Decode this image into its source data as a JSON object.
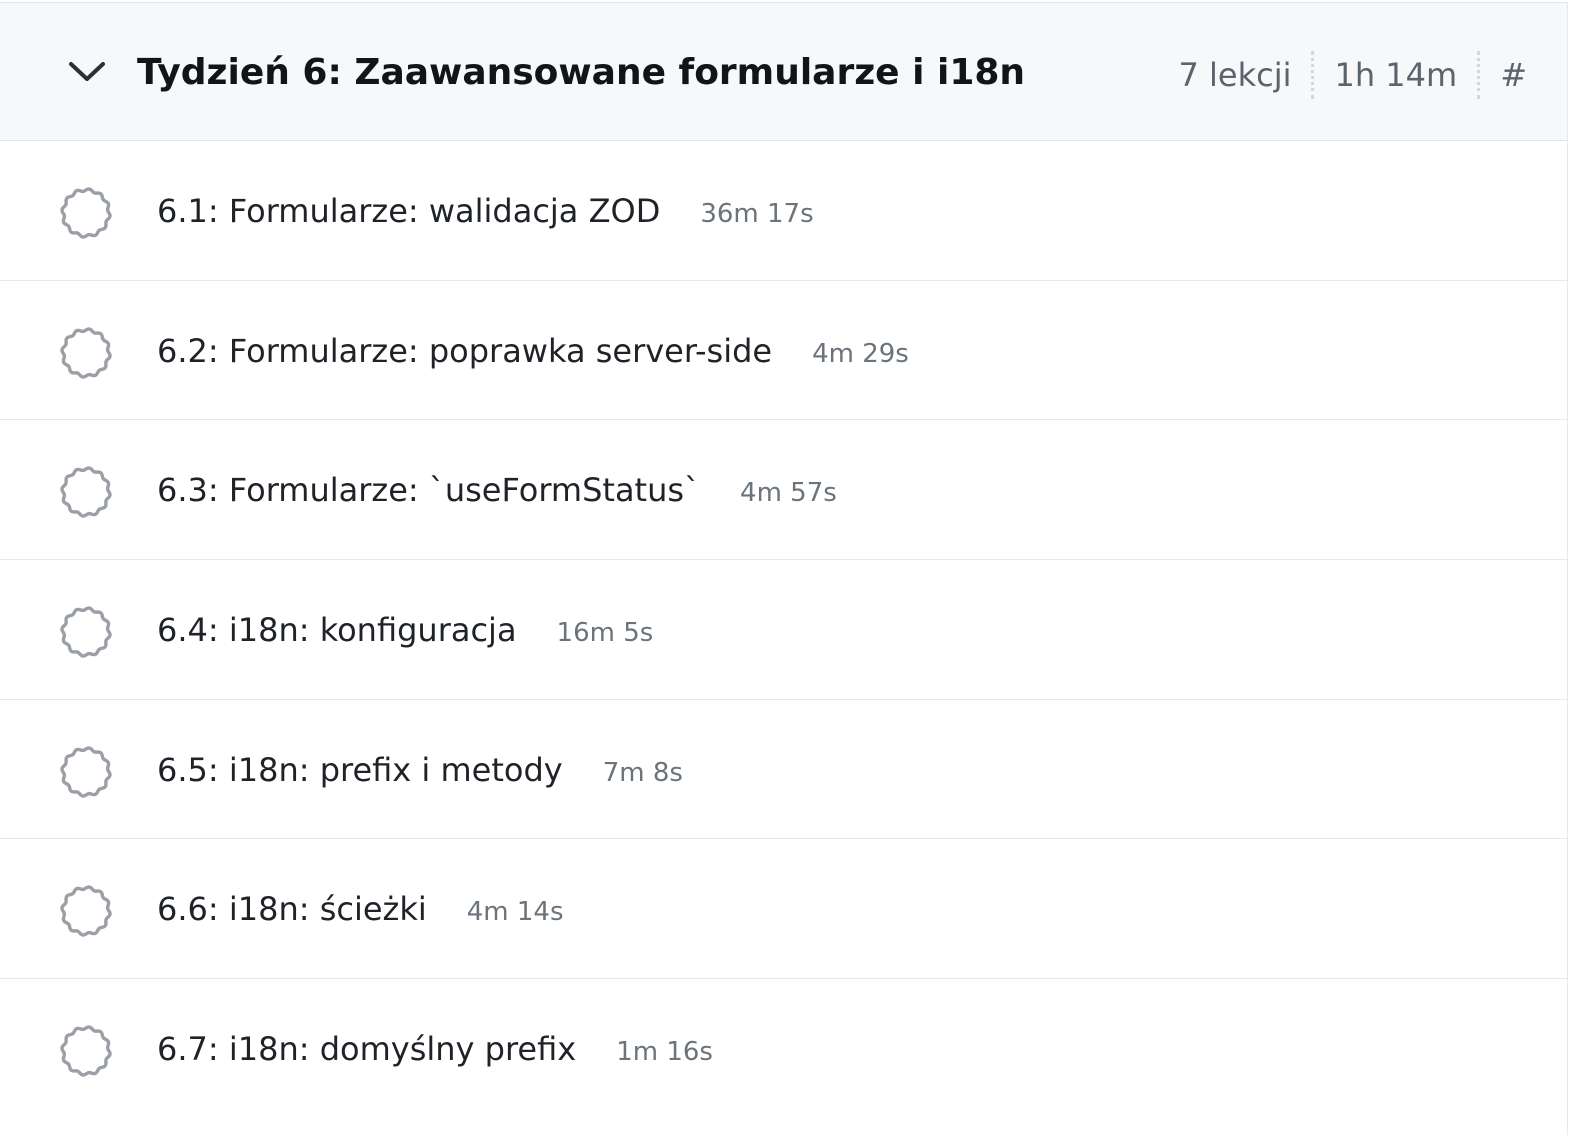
{
  "section": {
    "title": "Tydzień 6: Zaawansowane formularze i i18n",
    "lessons_count": "7 lekcji",
    "total_duration": "1h 14m",
    "anchor": "#",
    "expanded": true,
    "chevron_icon": "chevron-down-icon",
    "status_icon": "incomplete-circle-icon"
  },
  "lessons": [
    {
      "title": "6.1: Formularze: walidacja ZOD",
      "duration": "36m 17s"
    },
    {
      "title": "6.2: Formularze: poprawka server-side",
      "duration": "4m 29s"
    },
    {
      "title": "6.3: Formularze: `useFormStatus`",
      "duration": "4m 57s"
    },
    {
      "title": "6.4: i18n: konfiguracja",
      "duration": "16m 5s"
    },
    {
      "title": "6.5: i18n: prefix i metody",
      "duration": "7m 8s"
    },
    {
      "title": "6.6: i18n: ścieżki",
      "duration": "4m 14s"
    },
    {
      "title": "6.7: i18n: domyślny prefix",
      "duration": "1m 16s"
    }
  ],
  "colors": {
    "header_bg": "#f6f8fa",
    "border": "#e6e8eb",
    "text": "#1f2328",
    "muted": "#6b737b",
    "status_ring": "#9aa0a6"
  }
}
